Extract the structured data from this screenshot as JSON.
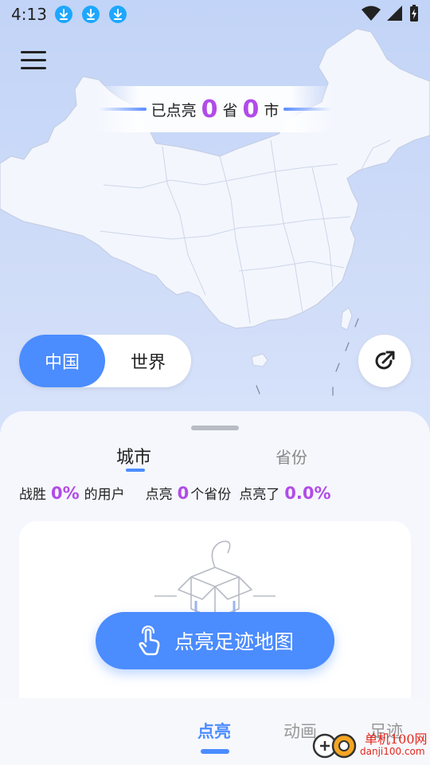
{
  "status_bar": {
    "time": "4:13",
    "notification_icons": [
      "download-icon",
      "download-icon",
      "download-icon"
    ],
    "right_icons": [
      "wifi-icon",
      "signal-icon",
      "battery-charging-icon"
    ]
  },
  "header": {
    "menu_icon": "menu-icon"
  },
  "lit_counter": {
    "prefix": "已点亮",
    "province_count": "0",
    "province_unit": "省",
    "city_count": "0",
    "city_unit": "市"
  },
  "region_toggle": {
    "options": [
      "中国",
      "世界"
    ],
    "selected": "中国"
  },
  "share_icon": "share-icon",
  "sheet": {
    "tabs": [
      "城市",
      "省份"
    ],
    "active_tab": "城市",
    "stats": {
      "beat_label": "战胜",
      "beat_value": "0%",
      "beat_suffix": "的用户",
      "lit_label": "点亮",
      "lit_value": "0",
      "lit_suffix": "个省份",
      "lit_ratio_label": "点亮了",
      "lit_ratio_value": "0.0%"
    },
    "empty_icon": "empty-box-icon"
  },
  "cta": {
    "label": "点亮足迹地图",
    "icon": "tap-hand-icon"
  },
  "bottom_nav": {
    "items": [
      "点亮",
      "动画",
      "足迹"
    ],
    "active": "点亮"
  },
  "watermark": {
    "title": "单机100网",
    "url": "danji100.com"
  },
  "colors": {
    "accent": "#4b8cff",
    "highlight": "#b24be8",
    "map_bg": "#c9d8f6"
  }
}
